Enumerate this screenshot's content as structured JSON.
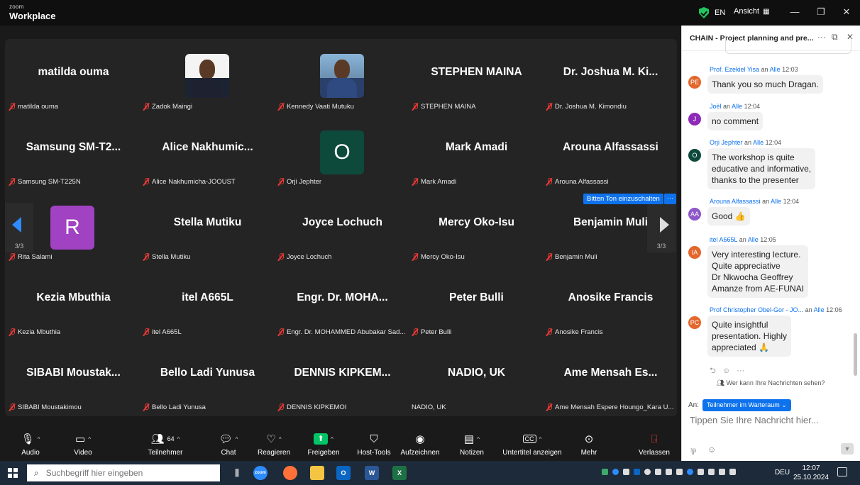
{
  "app": {
    "brand_small": "zoom",
    "brand_big": "Workplace",
    "language": "EN",
    "view_label": "Ansicht"
  },
  "participants": [
    {
      "name": "matilda ouma",
      "label": "matilda ouma",
      "type": "text"
    },
    {
      "name": "",
      "label": "Zadok Maingi",
      "type": "photo"
    },
    {
      "name": "",
      "label": "Kennedy Vaati Mutuku",
      "type": "photo"
    },
    {
      "name": "STEPHEN MAINA",
      "label": "STEPHEN MAINA",
      "type": "text"
    },
    {
      "name": "Dr. Joshua M. Ki...",
      "label": "Dr. Joshua M. Kimondiu",
      "type": "text"
    },
    {
      "name": "Samsung SM-T2...",
      "label": "Samsung SM-T225N",
      "type": "text"
    },
    {
      "name": "Alice Nakhumic...",
      "label": "Alice Nakhumicha-JOOUST",
      "type": "text"
    },
    {
      "name": "O",
      "label": "Orji Jephter",
      "type": "avatar",
      "color": "#0d4a3c"
    },
    {
      "name": "Mark Amadi",
      "label": "Mark Amadi",
      "type": "text"
    },
    {
      "name": "Arouna Alfassassi",
      "label": "Arouna Alfassassi",
      "type": "text"
    },
    {
      "name": "R",
      "label": "Rita Salami",
      "type": "avatar",
      "color": "#a142c2"
    },
    {
      "name": "Stella Mutiku",
      "label": "Stella Mutiku",
      "type": "text"
    },
    {
      "name": "Joyce Lochuch",
      "label": "Joyce Lochuch",
      "type": "text"
    },
    {
      "name": "Mercy Oko-Isu",
      "label": "Mercy Oko-Isu",
      "type": "text"
    },
    {
      "name": "Benjamin Muli",
      "label": "Benjamin Muli",
      "type": "text"
    },
    {
      "name": "Kezia Mbuthia",
      "label": "Kezia Mbuthia",
      "type": "text"
    },
    {
      "name": "itel A665L",
      "label": "itel A665L",
      "type": "text"
    },
    {
      "name": "Engr. Dr. MOHA...",
      "label": "Engr. Dr. MOHAMMED Abubakar Sad...",
      "type": "text"
    },
    {
      "name": "Peter Bulli",
      "label": "Peter Bulli",
      "type": "text"
    },
    {
      "name": "Anosike Francis",
      "label": "Anosike Francis",
      "type": "text"
    },
    {
      "name": "SIBABI Moustak...",
      "label": "SIBABI Moustakimou",
      "type": "text"
    },
    {
      "name": "Bello Ladi Yunusa",
      "label": "Bello Ladi Yunusa",
      "type": "text"
    },
    {
      "name": "DENNIS KIPKEM...",
      "label": "DENNIS KIPKEMOI",
      "type": "text"
    },
    {
      "name": "NADIO, UK",
      "label": "NADIO, UK",
      "type": "text",
      "unmuted": true
    },
    {
      "name": "Ame Mensah Es...",
      "label": "Ame Mensah Espere Houngo_Kara U...",
      "type": "text"
    }
  ],
  "pager": {
    "left": "3/3",
    "right": "3/3"
  },
  "unmute_request": "Bitten Ton einzuschalten",
  "unmute_more": "···",
  "toolbar": {
    "audio": "Audio",
    "video": "Video",
    "participants": "Teilnehmer",
    "participant_count": "64",
    "chat": "Chat",
    "reactions": "Reagieren",
    "share": "Freigeben",
    "host_tools": "Host-Tools",
    "record": "Aufzeichnen",
    "notes": "Notizen",
    "captions": "Untertitel anzeigen",
    "more": "Mehr",
    "leave": "Verlassen"
  },
  "chat": {
    "title": "CHAIN - Project planning and pre...",
    "connector": "an",
    "messages": [
      {
        "sender": "Prof. Ezekiel Yisa",
        "to": "Alle",
        "time": "12:03",
        "initials": "PE",
        "color": "#e3662b",
        "lines": [
          "Thank you so much Dragan."
        ]
      },
      {
        "sender": "Joël",
        "to": "Alle",
        "time": "12:04",
        "initials": "J",
        "color": "#8e2ab8",
        "lines": [
          "no comment"
        ]
      },
      {
        "sender": "Orji Jephter",
        "to": "Alle",
        "time": "12:04",
        "initials": "O",
        "color": "#0d4a3c",
        "lines": [
          "The workshop is quite",
          "educative and informative,",
          "thanks to the presenter"
        ]
      },
      {
        "sender": "Arouna Alfassassi",
        "to": "Alle",
        "time": "12:04",
        "initials": "AA",
        "color": "#8e57c9",
        "lines": [
          "Good 👍"
        ]
      },
      {
        "sender": "itel A665L",
        "to": "Alle",
        "time": "12:05",
        "initials": "IA",
        "color": "#e3662b",
        "lines": [
          "Very interesting lecture.",
          "Quite appreciative",
          "Dr Nkwocha Geoffrey",
          "Amanze from AE-FUNAI"
        ]
      },
      {
        "sender": "Prof Christopher Obel-Gor - JO...",
        "to": "Alle",
        "time": "12:06",
        "initials": "PC",
        "color": "#e3662b",
        "lines": [
          "Quite insightful",
          "presentation.  Highly",
          "appreciated 🙏"
        ]
      }
    ],
    "who_can_see": "Wer kann Ihre Nachrichten sehen?",
    "to_label": "An:",
    "to_value": "Teilnehmer im Warteraum",
    "input_placeholder": "Tippen Sie Ihre Nachricht hier..."
  },
  "taskbar": {
    "search_placeholder": "Suchbegriff hier eingeben",
    "lang": "DEU",
    "time": "12:07",
    "date": "25.10.2024"
  },
  "colors": {
    "accent": "#0e72ed",
    "muted_red": "#e53935",
    "tile_bg": "#242424"
  }
}
